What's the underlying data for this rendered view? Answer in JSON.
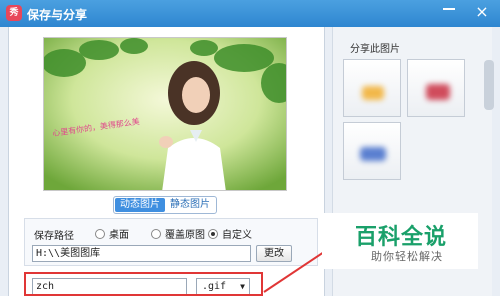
{
  "window": {
    "title": "保存与分享",
    "app_icon": "秀",
    "close_glyph": "×"
  },
  "preview": {
    "caption": "心里有你的，美得那么美"
  },
  "tabs": [
    {
      "label": "动态图片",
      "active": true
    },
    {
      "label": "静态图片",
      "active": false
    }
  ],
  "save": {
    "path_label": "保存路径",
    "options": [
      {
        "label": "桌面",
        "selected": false
      },
      {
        "label": "覆盖原图",
        "selected": false
      },
      {
        "label": "自定义",
        "selected": true
      }
    ],
    "path_value": "H:\\\\美图图库",
    "change_button": "更改",
    "filename": "zch",
    "format": ".gif"
  },
  "share": {
    "title": "分享此图片"
  },
  "watermark": {
    "title": "百科全说",
    "subtitle": "助你轻松解决"
  },
  "colors": {
    "titlebar": "#3a93d8",
    "accent": "#3f8fe0",
    "highlight": "#e03636",
    "watermark": "#1aa06a"
  }
}
